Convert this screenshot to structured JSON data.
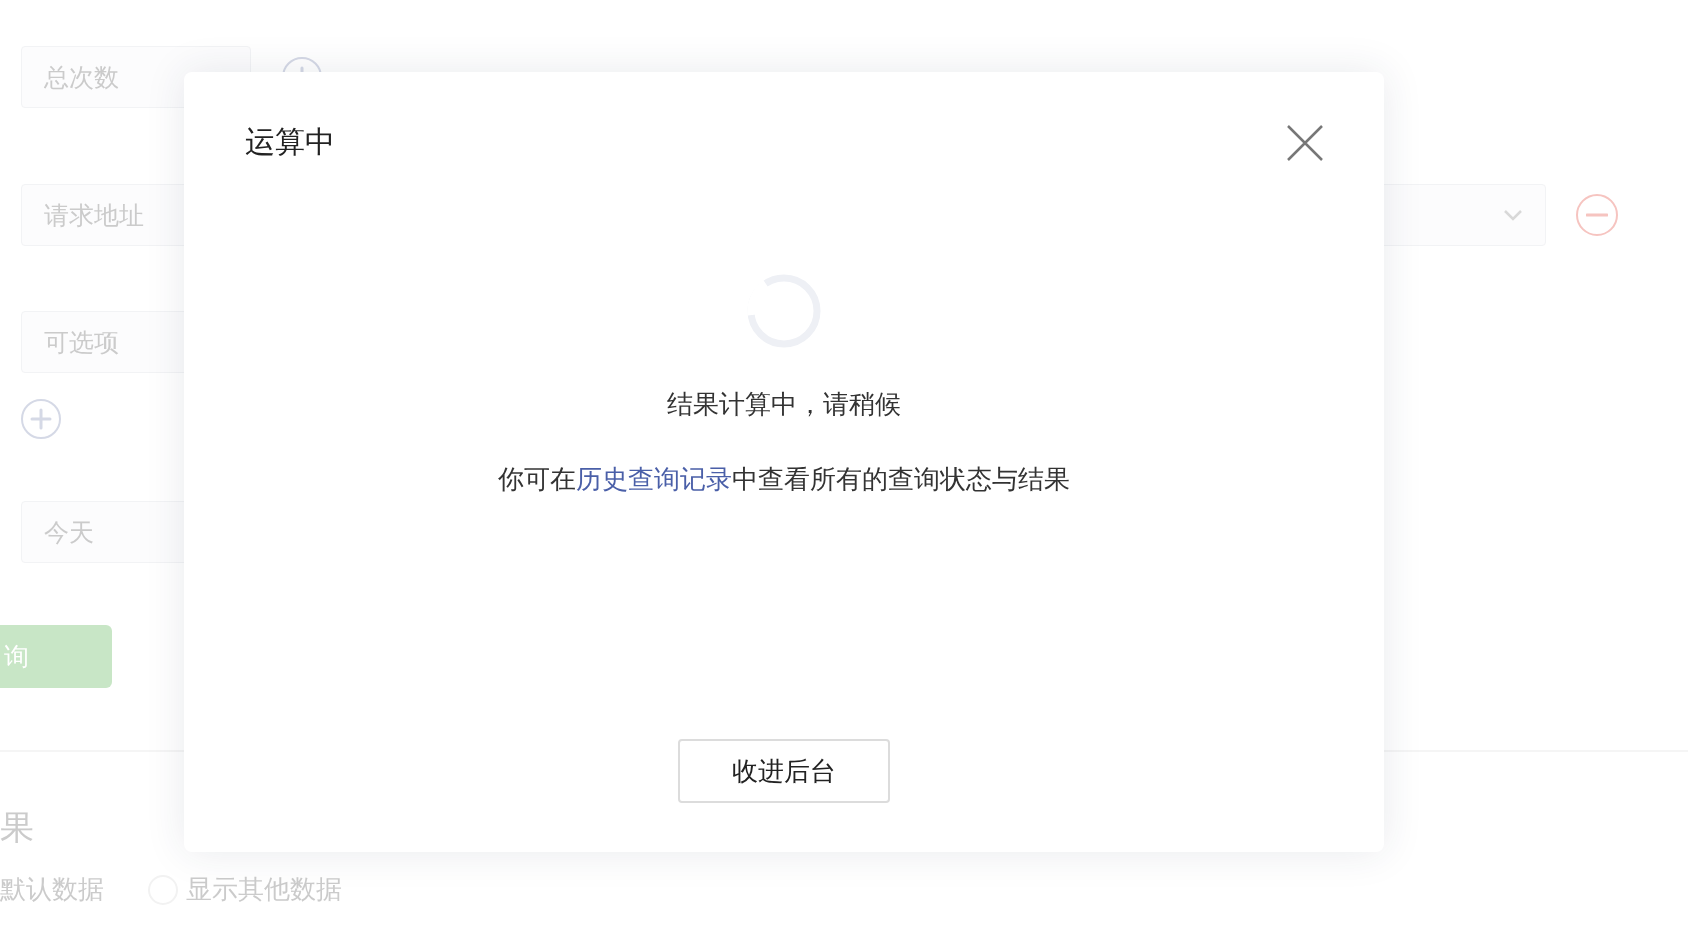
{
  "background_form": {
    "fields": [
      {
        "placeholder": "总次数"
      },
      {
        "placeholder": "请求地址"
      },
      {
        "placeholder": "可选项"
      },
      {
        "placeholder": "今天"
      }
    ],
    "query_button": "询",
    "results_title": "果",
    "radios": [
      {
        "label": "默认数据"
      },
      {
        "label": "显示其他数据",
        "selected": false
      }
    ]
  },
  "dialog": {
    "title": "运算中",
    "message": "结果计算中，请稍候",
    "hint": {
      "before": "你可在",
      "link": "历史查询记录",
      "after": "中查看所有的查询状态与结果"
    },
    "button": "收进后台"
  }
}
